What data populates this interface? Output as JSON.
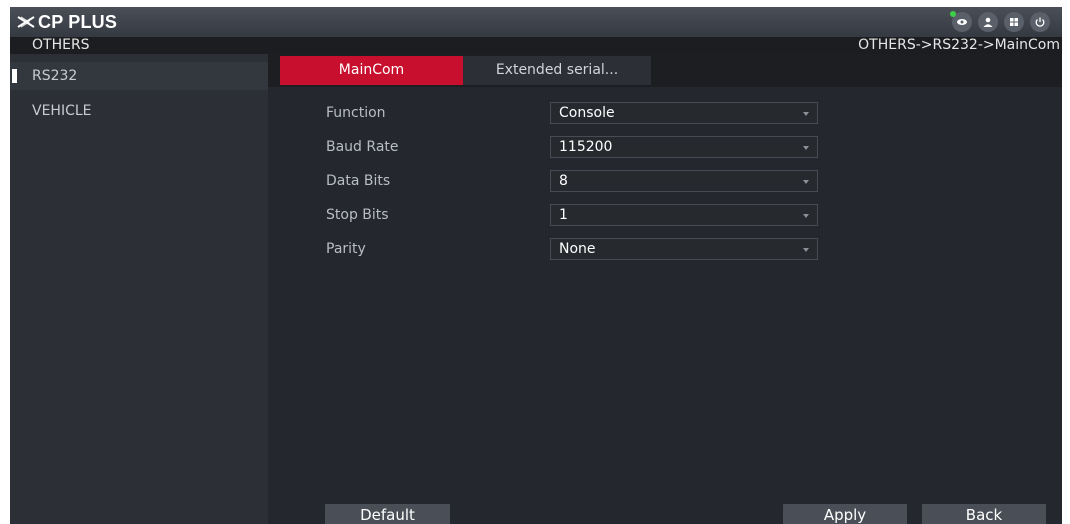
{
  "app": {
    "brand": "CP PLUS"
  },
  "header": {
    "section_title": "OTHERS",
    "breadcrumb": "OTHERS->RS232->MainCom",
    "icons": [
      "live-view-icon",
      "user-icon",
      "menu-grid-icon",
      "power-icon"
    ],
    "live_indicator_color": "#3ecf4a"
  },
  "sidebar": {
    "items": [
      {
        "label": "RS232",
        "active": true
      },
      {
        "label": "VEHICLE",
        "active": false
      }
    ]
  },
  "tabs": [
    {
      "label": "MainCom",
      "active": true
    },
    {
      "label": "Extended serial...",
      "active": false
    }
  ],
  "form": {
    "fields": [
      {
        "label": "Function",
        "value": "Console"
      },
      {
        "label": "Baud Rate",
        "value": "115200"
      },
      {
        "label": "Data Bits",
        "value": "8"
      },
      {
        "label": "Stop Bits",
        "value": "1"
      },
      {
        "label": "Parity",
        "value": "None"
      }
    ]
  },
  "buttons": {
    "default_label": "Default",
    "apply_label": "Apply",
    "back_label": "Back"
  },
  "colors": {
    "accent": "#c8102e",
    "background": "#24272d",
    "sidebar": "#2c2f35"
  }
}
